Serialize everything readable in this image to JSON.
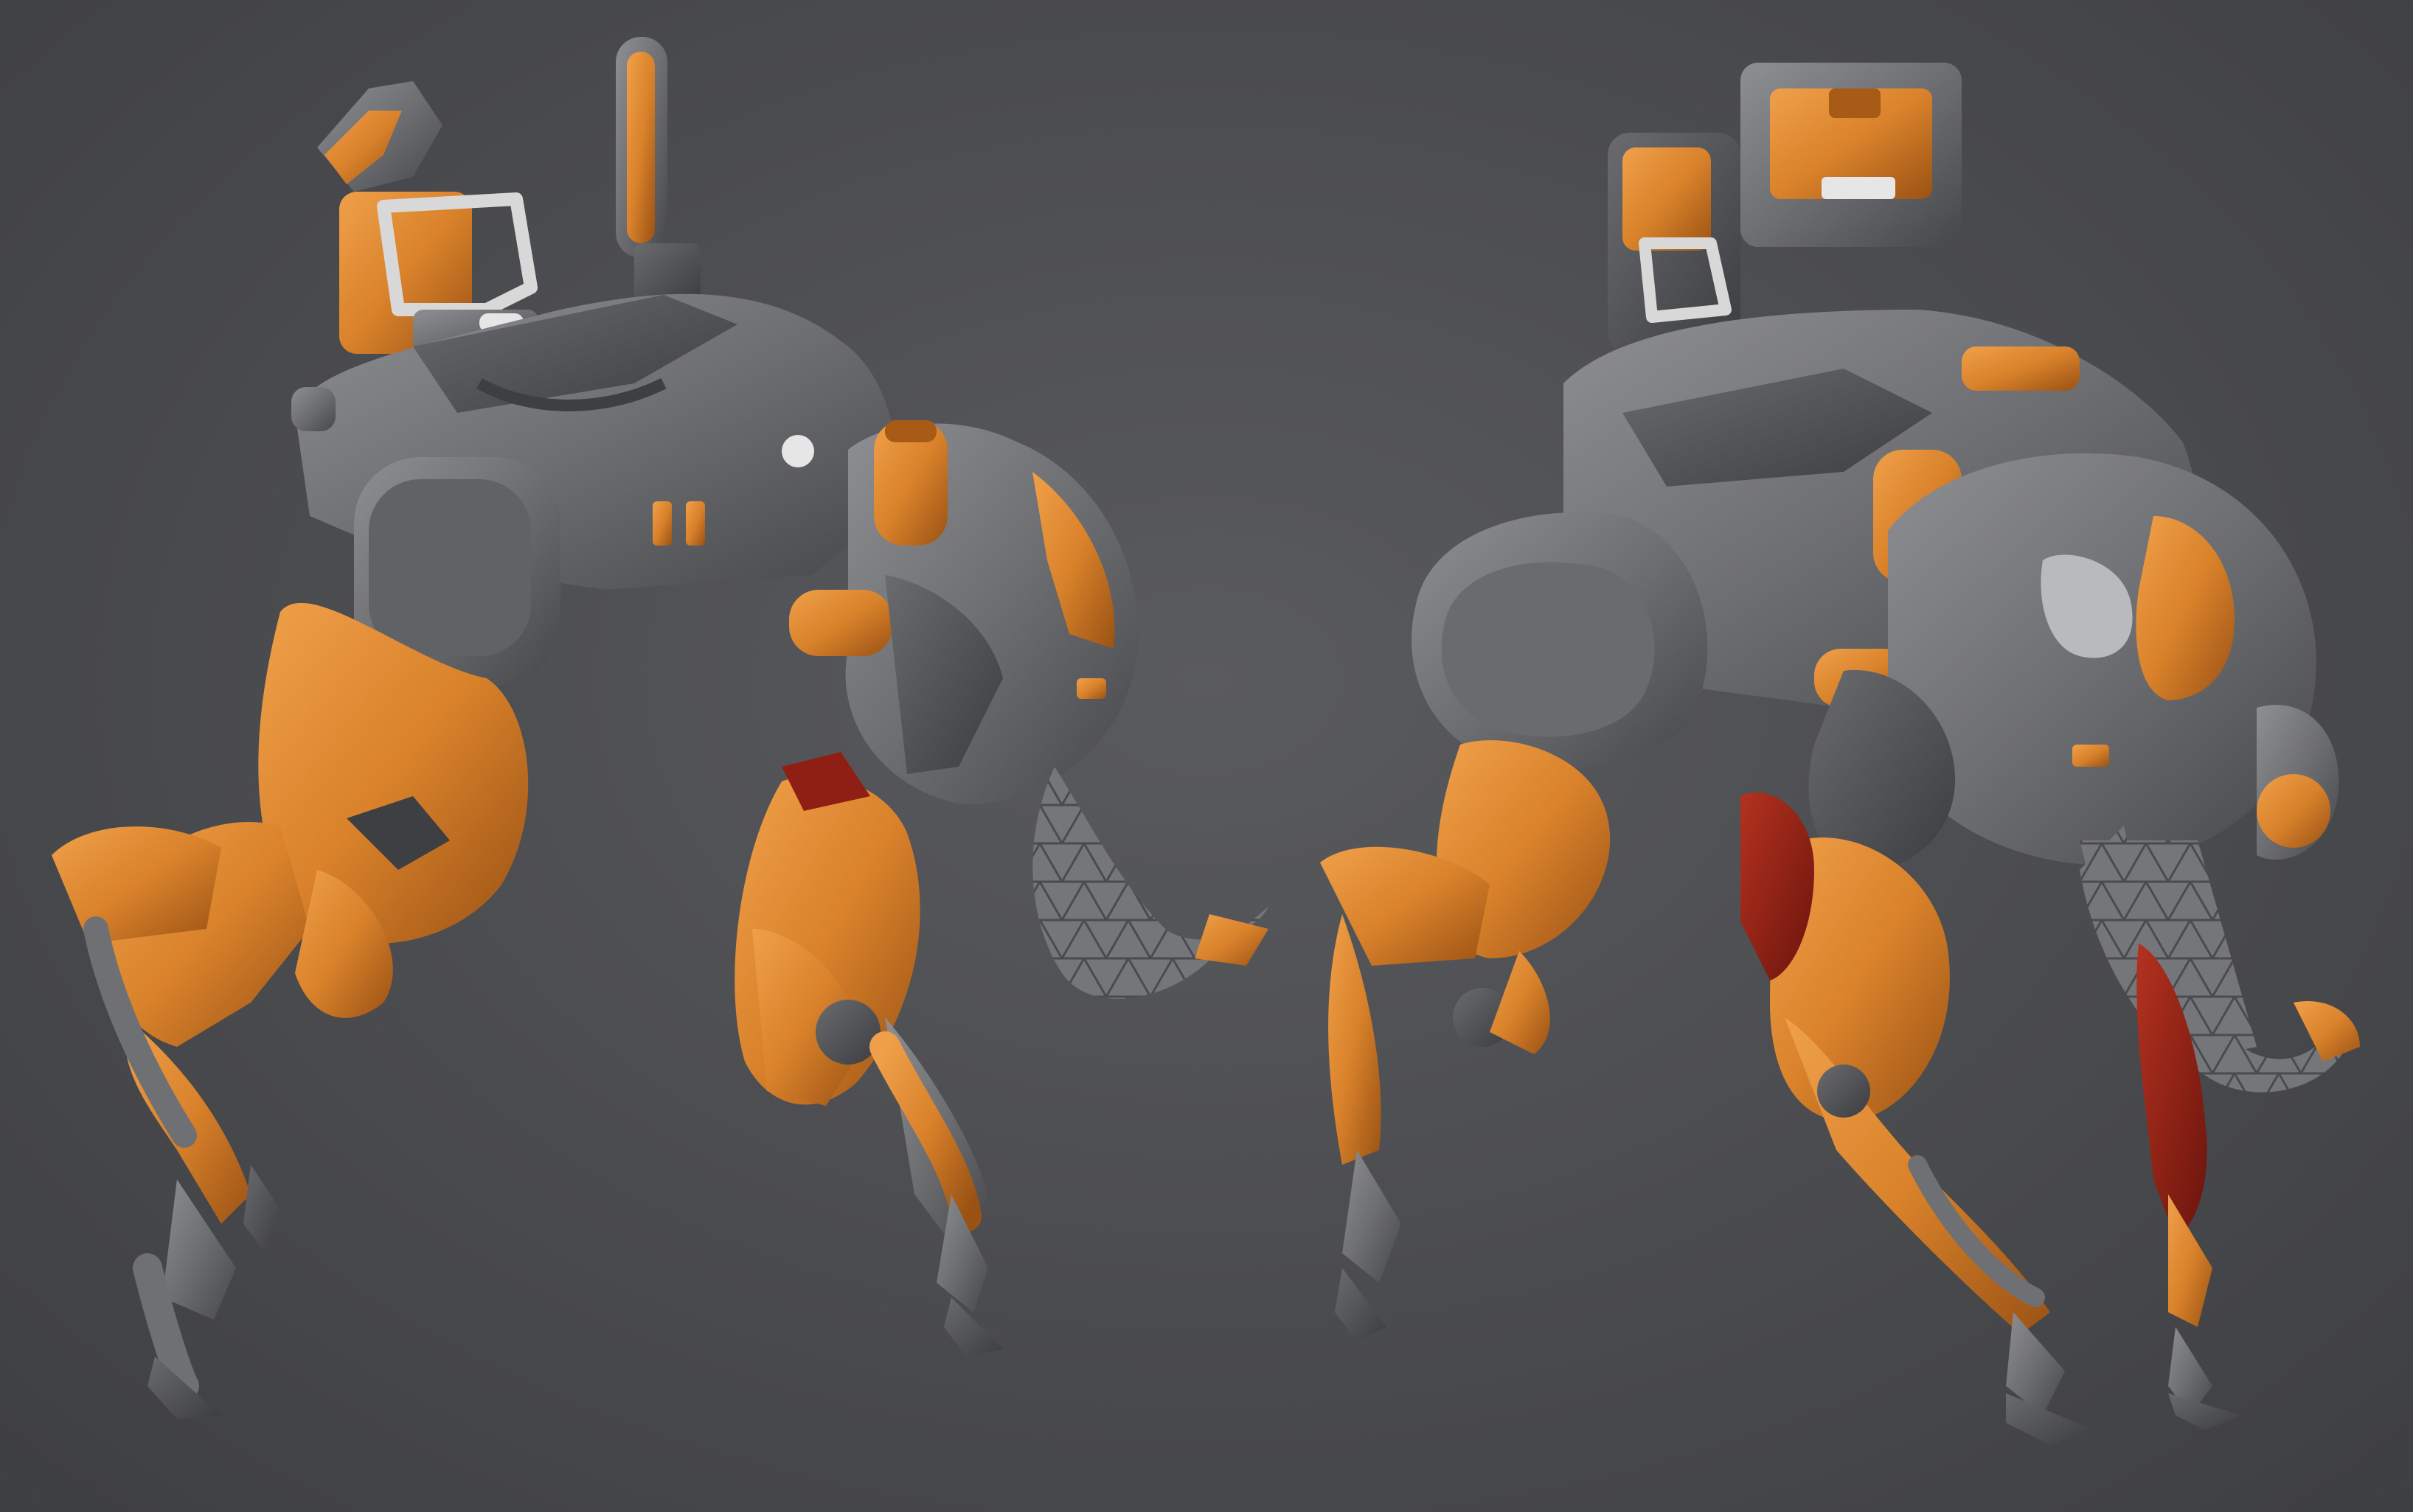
{
  "scene": {
    "subject": "quadruped-mech-render",
    "views": [
      "side-view",
      "three-quarter-view"
    ]
  },
  "colors": {
    "background": "#4d4e51",
    "armor_orange": "#d9822b",
    "armor_orange_dark": "#a85a17",
    "armor_orange_light": "#ee9a44",
    "metal_gray": "#6f7073",
    "metal_gray_dark": "#4e4f52",
    "metal_gray_light": "#8c8d90",
    "accent_red": "#8f1e14",
    "highlight_white": "#e6e6e6"
  }
}
